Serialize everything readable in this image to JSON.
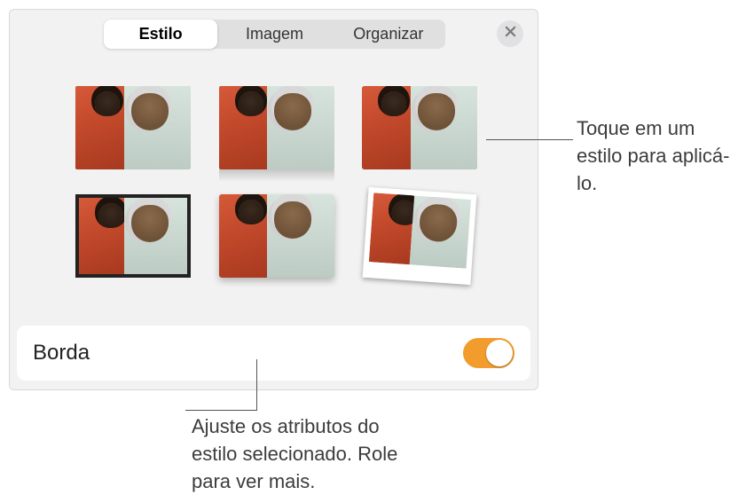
{
  "tabs": {
    "style": "Estilo",
    "image": "Imagem",
    "arrange": "Organizar"
  },
  "styles": [
    {
      "name": "plain"
    },
    {
      "name": "reflect"
    },
    {
      "name": "thinborder"
    },
    {
      "name": "thickborder"
    },
    {
      "name": "shadow"
    },
    {
      "name": "polaroid"
    }
  ],
  "border": {
    "label": "Borda",
    "on": true
  },
  "callouts": {
    "apply_style": "Toque em um estilo para aplicá-lo.",
    "adjust_attrs": "Ajuste os atributos do estilo selecionado. Role para ver mais."
  }
}
